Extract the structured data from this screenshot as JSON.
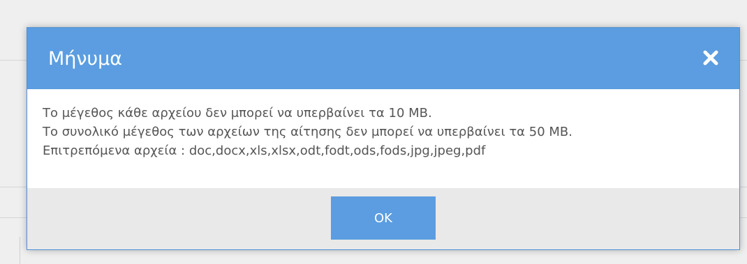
{
  "dialog": {
    "title": "Μήνυμα",
    "close_icon": "close-icon",
    "messages": [
      "Το μέγεθος κάθε αρχείου δεν μπορεί να υπερβαίνει τα 10 MB.",
      "Το συνολικό μέγεθος των αρχείων της αίτησης δεν μπορεί να υπερβαίνει τα 50 MB.",
      "Επιτρεπόμενα αρχεία : doc,docx,xls,xlsx,odt,fodt,ods,fods,jpg,jpeg,pdf"
    ],
    "ok_label": "OK"
  },
  "colors": {
    "header": "#5b9de0",
    "button": "#5b9de0",
    "footer": "#e9e9e9",
    "text": "#555555"
  }
}
